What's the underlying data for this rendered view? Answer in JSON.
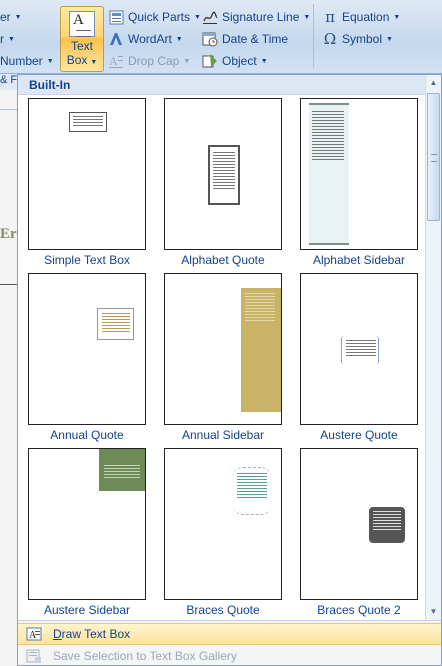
{
  "ribbon": {
    "left_cut_1": "er",
    "left_cut_2": "r",
    "left_cut_3": "Number",
    "left_cut_4": "& F",
    "text_box": {
      "line1": "Text",
      "line2": "Box"
    },
    "quick_parts": "Quick Parts",
    "wordart": "WordArt",
    "drop_cap": "Drop Cap",
    "signature_line": "Signature Line",
    "date_time": "Date & Time",
    "object": "Object",
    "equation": "Equation",
    "symbol": "Symbol"
  },
  "document": {
    "visible_fragment": "Er"
  },
  "gallery": {
    "section": "Built-In",
    "tiles": [
      {
        "name": "Simple Text Box"
      },
      {
        "name": "Alphabet Quote"
      },
      {
        "name": "Alphabet Sidebar"
      },
      {
        "name": "Annual Quote"
      },
      {
        "name": "Annual Sidebar"
      },
      {
        "name": "Austere Quote"
      },
      {
        "name": "Austere Sidebar"
      },
      {
        "name": "Braces Quote"
      },
      {
        "name": "Braces Quote 2"
      }
    ],
    "footer": {
      "draw_text_box": "Draw Text Box",
      "draw_text_box_accel": "D",
      "draw_text_box_rest": "raw Text Box",
      "save_selection": "Save Selection to Text Box Gallery"
    }
  },
  "colors": {
    "ribbon_text": "#15428b",
    "highlight": "#fde49c",
    "annual_sidebar": "#c9b366",
    "austere_sidebar": "#6e8a57",
    "braces_quote_2": "#555555",
    "alphabet_sidebar": "#e9f3f3"
  }
}
